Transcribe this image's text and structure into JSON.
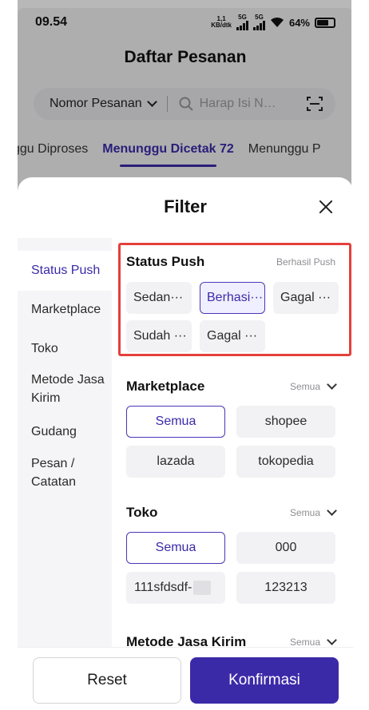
{
  "status_bar": {
    "time": "09.54",
    "net_speed": "1,1",
    "net_unit": "KB/dtk",
    "sig1": "5G",
    "sig2": "5G",
    "battery": "64%"
  },
  "page": {
    "title": "Daftar Pesanan",
    "search_type": "Nomor Pesanan",
    "search_placeholder": "Harap Isi N…",
    "tabs": [
      "ggu Diproses",
      "Menunggu Dicetak 72",
      "Menunggu P"
    ]
  },
  "filter": {
    "title": "Filter",
    "sidebar": [
      "Status Push",
      "Marketplace",
      "Toko",
      "Metode Jasa Kirim",
      "Gudang",
      "Pesan / Catatan"
    ],
    "sections": {
      "status_push": {
        "title": "Status Push",
        "hint": "Berhasil Push",
        "options": [
          "Sedan···",
          "Berhasi···",
          "Gagal ···",
          "Sudah ···",
          "Gagal ···"
        ]
      },
      "marketplace": {
        "title": "Marketplace",
        "hint": "Semua",
        "options": [
          "Semua",
          "shopee",
          "lazada",
          "tokopedia"
        ]
      },
      "toko": {
        "title": "Toko",
        "hint": "Semua",
        "options": [
          "Semua",
          "000",
          "111sfdsdf-",
          "123213"
        ]
      },
      "metode": {
        "title": "Metode Jasa Kirim",
        "hint": "Semua"
      }
    },
    "reset_label": "Reset",
    "confirm_label": "Konfirmasi"
  },
  "colors": {
    "accent": "#3b2aa8",
    "highlight": "#e4403b"
  }
}
